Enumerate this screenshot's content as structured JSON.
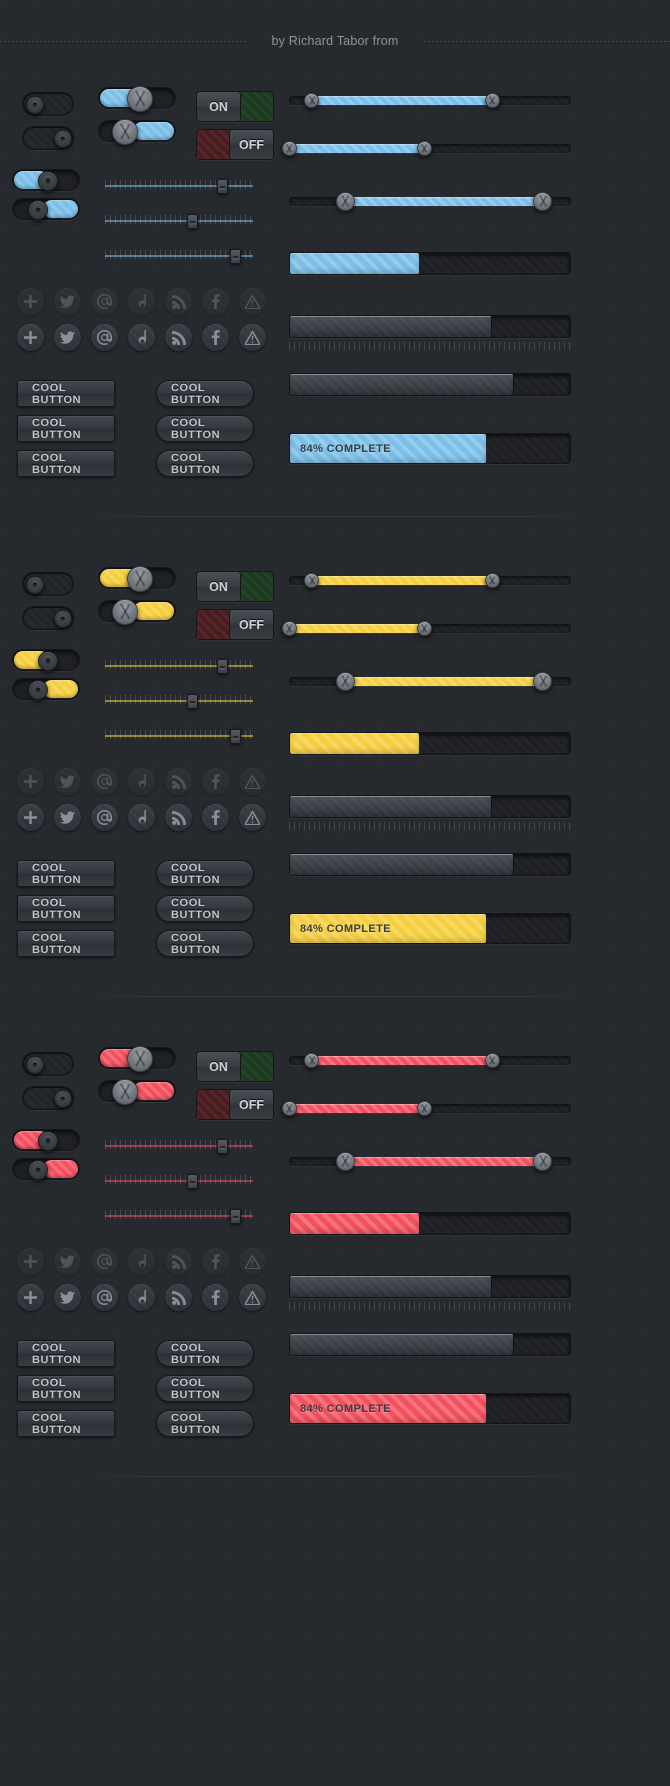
{
  "header": {
    "title": "by Richard Tabor from"
  },
  "labels": {
    "on": "ON",
    "off": "OFF",
    "cool_button": "COOL BUTTON",
    "progress_complete": "84% COMPLETE"
  },
  "icons": [
    {
      "name": "plus-icon",
      "glyph": "+"
    },
    {
      "name": "twitter-icon",
      "glyph": "twitter"
    },
    {
      "name": "at-icon",
      "glyph": "@"
    },
    {
      "name": "dribbble-icon",
      "glyph": "d"
    },
    {
      "name": "rss-icon",
      "glyph": "rss"
    },
    {
      "name": "facebook-icon",
      "glyph": "f"
    },
    {
      "name": "warning-icon",
      "glyph": "triangle"
    }
  ],
  "variants": [
    {
      "id": "blue",
      "accent": "#7cbfe8",
      "accent_dark": "#4b93c4",
      "toggles": [
        {
          "state": "off",
          "style": "dark"
        },
        {
          "state": "off",
          "style": "dark-right"
        },
        {
          "state": "on",
          "style": "accent"
        },
        {
          "state": "on",
          "style": "accent-right"
        },
        {
          "state": "on",
          "style": "accent-big"
        },
        {
          "state": "on",
          "style": "accent-big-right"
        }
      ],
      "onoff": {
        "on_label": "ON",
        "off_label": "OFF"
      },
      "sliders": [
        {
          "value": 82
        },
        {
          "value": 60
        },
        {
          "value": 92
        }
      ],
      "ranges": [
        {
          "start": 8,
          "end": 72
        },
        {
          "start": 0,
          "end": 48
        },
        {
          "start": 20,
          "end": 90
        }
      ],
      "progress": [
        {
          "value": 46,
          "label": "",
          "style": "accent"
        },
        {
          "value": 72,
          "label": "",
          "style": "grey"
        },
        {
          "value": 80,
          "label": "",
          "style": "grey"
        },
        {
          "value": 70,
          "label": "84% COMPLETE",
          "style": "accent"
        }
      ],
      "buttons_rect": [
        "COOL BUTTON",
        "COOL BUTTON",
        "COOL BUTTON"
      ],
      "buttons_round": [
        "COOL BUTTON",
        "COOL BUTTON",
        "COOL BUTTON"
      ]
    },
    {
      "id": "yellow",
      "accent": "#f5cf3f",
      "accent_dark": "#c9a417",
      "toggles": [
        {
          "state": "off",
          "style": "dark"
        },
        {
          "state": "off",
          "style": "dark-right"
        },
        {
          "state": "on",
          "style": "accent"
        },
        {
          "state": "on",
          "style": "accent-right"
        },
        {
          "state": "on",
          "style": "accent-big"
        },
        {
          "state": "on",
          "style": "accent-big-right"
        }
      ],
      "onoff": {
        "on_label": "ON",
        "off_label": "OFF"
      },
      "sliders": [
        {
          "value": 82
        },
        {
          "value": 60
        },
        {
          "value": 92
        }
      ],
      "ranges": [
        {
          "start": 8,
          "end": 72
        },
        {
          "start": 0,
          "end": 48
        },
        {
          "start": 20,
          "end": 90
        }
      ],
      "progress": [
        {
          "value": 46,
          "label": "",
          "style": "accent"
        },
        {
          "value": 72,
          "label": "",
          "style": "grey"
        },
        {
          "value": 80,
          "label": "",
          "style": "grey"
        },
        {
          "value": 70,
          "label": "84% COMPLETE",
          "style": "accent"
        }
      ],
      "buttons_rect": [
        "COOL BUTTON",
        "COOL BUTTON",
        "COOL BUTTON"
      ],
      "buttons_round": [
        "COOL BUTTON",
        "COOL BUTTON",
        "COOL BUTTON"
      ]
    },
    {
      "id": "red",
      "accent": "#f4515f",
      "accent_dark": "#c42f3c",
      "toggles": [
        {
          "state": "off",
          "style": "dark"
        },
        {
          "state": "off",
          "style": "dark-right"
        },
        {
          "state": "on",
          "style": "accent"
        },
        {
          "state": "on",
          "style": "accent-right"
        },
        {
          "state": "on",
          "style": "accent-big"
        },
        {
          "state": "on",
          "style": "accent-big-right"
        }
      ],
      "onoff": {
        "on_label": "ON",
        "off_label": "OFF"
      },
      "sliders": [
        {
          "value": 82
        },
        {
          "value": 60
        },
        {
          "value": 92
        }
      ],
      "ranges": [
        {
          "start": 8,
          "end": 72
        },
        {
          "start": 0,
          "end": 48
        },
        {
          "start": 20,
          "end": 90
        }
      ],
      "progress": [
        {
          "value": 46,
          "label": "",
          "style": "accent"
        },
        {
          "value": 72,
          "label": "",
          "style": "grey"
        },
        {
          "value": 80,
          "label": "",
          "style": "grey"
        },
        {
          "value": 70,
          "label": "84% COMPLETE",
          "style": "accent"
        }
      ],
      "buttons_rect": [
        "COOL BUTTON",
        "COOL BUTTON",
        "COOL BUTTON"
      ],
      "buttons_round": [
        "COOL BUTTON",
        "COOL BUTTON",
        "COOL BUTTON"
      ]
    }
  ]
}
